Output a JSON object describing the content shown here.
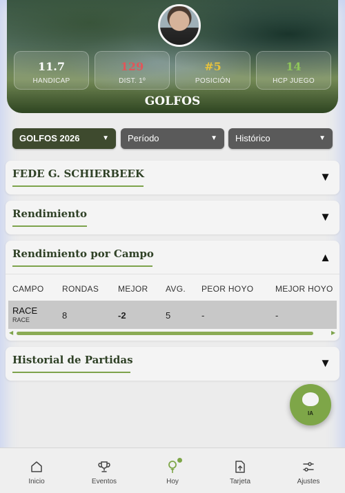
{
  "header": {
    "stats": [
      {
        "value": "11.7",
        "label": "HANDICAP",
        "color": "#ffffff"
      },
      {
        "value": "129",
        "label": "DIST. 1º",
        "color": "#e0565a"
      },
      {
        "value": "#5",
        "label": "POSICIÓN",
        "color": "#e8c33c"
      },
      {
        "value": "14",
        "label": "HCP JUEGO",
        "color": "#8fc65a"
      }
    ],
    "club_name": "GOLFOS"
  },
  "filters": {
    "group": "GOLFOS 2026",
    "period": "Período",
    "history": "Histórico"
  },
  "cards": {
    "player": {
      "title": "FEDE G. SCHIERBEEK",
      "toggle": "▼"
    },
    "performance": {
      "title": "Rendimiento",
      "toggle": "▼"
    },
    "course_performance": {
      "title": "Rendimiento por Campo",
      "toggle": "▲"
    },
    "match_history": {
      "title": "Historial de Partidas",
      "toggle": "▼"
    }
  },
  "table": {
    "headers": [
      "CAMPO",
      "RONDAS",
      "MEJOR",
      "AVG.",
      "PEOR HOYO",
      "MEJOR HOYO"
    ],
    "rows": [
      {
        "course": "RACE",
        "course_sub": "RACE",
        "rounds": "8",
        "best": "-2",
        "avg": "5",
        "worst_hole": "-",
        "best_hole": "-"
      }
    ]
  },
  "fab": {
    "label": "IA"
  },
  "nav": {
    "items": [
      {
        "label": "Inicio",
        "icon": "home-icon"
      },
      {
        "label": "Eventos",
        "icon": "trophy-icon"
      },
      {
        "label": "Hoy",
        "icon": "golf-tee-icon"
      },
      {
        "label": "Tarjeta",
        "icon": "scorecard-icon"
      },
      {
        "label": "Ajustes",
        "icon": "sliders-icon"
      }
    ]
  },
  "colors": {
    "accent": "#7ea648",
    "dark_green": "#3e4a2e"
  }
}
